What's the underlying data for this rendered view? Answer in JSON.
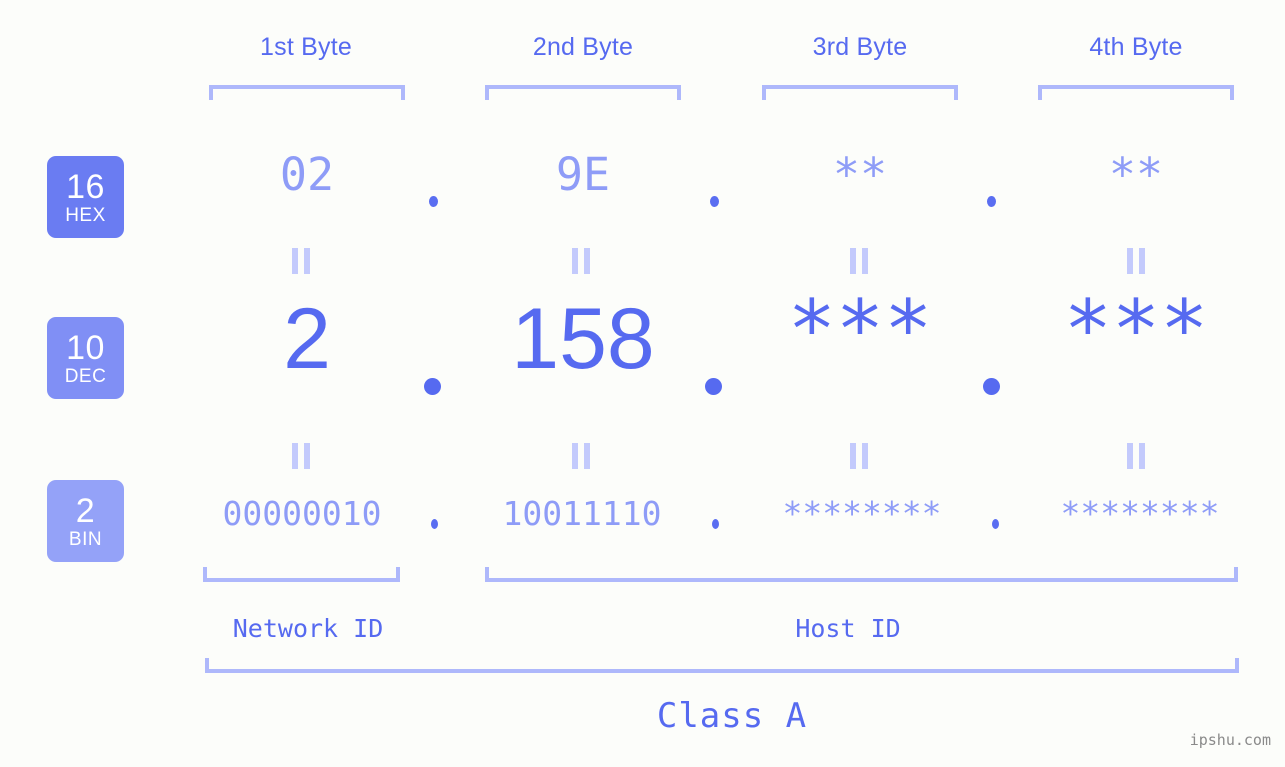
{
  "page": {
    "background_color": "#fcfdfa",
    "accent_color": "#566af0",
    "muted_accent_color": "#8e9cf7",
    "bracket_color": "#aeb8fb",
    "watermark": "ipshu.com"
  },
  "header": {
    "byte_labels": [
      {
        "label": "1st Byte"
      },
      {
        "label": "2nd Byte"
      },
      {
        "label": "3rd Byte"
      },
      {
        "label": "4th Byte"
      }
    ]
  },
  "radix_badges": [
    {
      "number": "16",
      "radix": "HEX",
      "color": "#6a7cf2"
    },
    {
      "number": "10",
      "radix": "DEC",
      "color": "#808ff5"
    },
    {
      "number": "2",
      "radix": "BIN",
      "color": "#94a2f8"
    }
  ],
  "rows": {
    "hex": {
      "radix_number": "16",
      "radix_name": "HEX",
      "values": [
        "02",
        "9E",
        "**",
        "**"
      ],
      "separator": "."
    },
    "dec": {
      "radix_number": "10",
      "radix_name": "DEC",
      "values": [
        "2",
        "158",
        "***",
        "***"
      ],
      "separator": "."
    },
    "bin": {
      "radix_number": "2",
      "radix_name": "BIN",
      "values": [
        "00000010",
        "10011110",
        "********",
        "********"
      ],
      "separator": "."
    }
  },
  "equals_separators": {
    "glyph": "=",
    "count_per_row": 4,
    "rows": 2
  },
  "footer": {
    "network_id_label": "Network ID",
    "host_id_label": "Host ID",
    "class_label": "Class A"
  }
}
